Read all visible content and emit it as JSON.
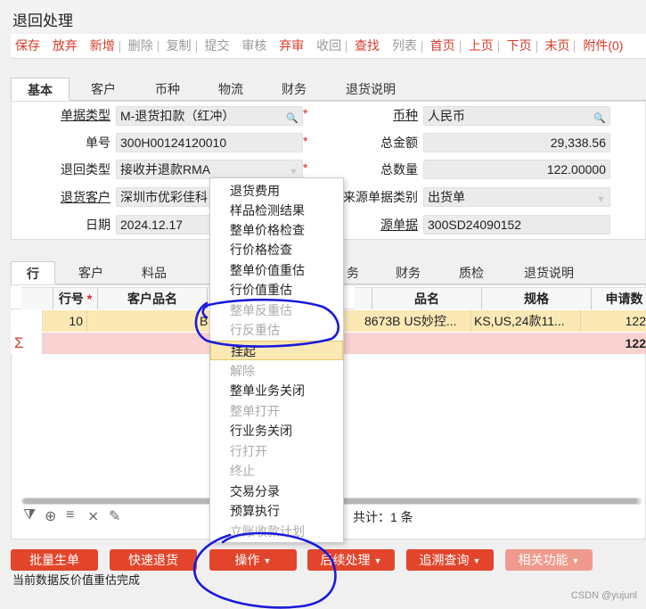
{
  "window": {
    "title": "退回处理"
  },
  "toolbar": {
    "items": [
      {
        "label": "保存",
        "disabled": false
      },
      {
        "label": "放弃",
        "disabled": false
      },
      {
        "label": "新增",
        "disabled": false
      },
      {
        "label": "删除",
        "disabled": true
      },
      {
        "label": "复制",
        "disabled": true
      },
      {
        "label": "提交",
        "disabled": true
      },
      {
        "label": "审核",
        "disabled": true
      },
      {
        "label": "弃审",
        "disabled": false
      },
      {
        "label": "收回",
        "disabled": true
      },
      {
        "label": "查找",
        "disabled": false
      },
      {
        "label": "列表",
        "disabled": true
      },
      {
        "label": "首页",
        "disabled": false
      },
      {
        "label": "上页",
        "disabled": false
      },
      {
        "label": "下页",
        "disabled": false
      },
      {
        "label": "末页",
        "disabled": false
      },
      {
        "label": "附件(0)",
        "disabled": false
      }
    ]
  },
  "header_tabs": [
    "基本",
    "客户",
    "币种",
    "物流",
    "财务",
    "退货说明"
  ],
  "form": {
    "doc_type": {
      "label": "单据类型",
      "value": "M-退货扣款（红冲）"
    },
    "currency": {
      "label": "币种",
      "value": "人民币"
    },
    "doc_no": {
      "label": "单号",
      "value": "300H00124120010"
    },
    "total_amount": {
      "label": "总金额",
      "value": "29,338.56"
    },
    "return_type": {
      "label": "退回类型",
      "value": "接收并退款RMA"
    },
    "total_qty": {
      "label": "总数量",
      "value": "122.00000"
    },
    "return_customer": {
      "label": "退货客户",
      "value": "深圳市优彩佳科"
    },
    "source_doc_type": {
      "label": "来源单据类别",
      "value": "出货单"
    },
    "date": {
      "label": "日期",
      "value": "2024.12.17"
    },
    "source_doc": {
      "label": "源单据",
      "value": "300SD24090152"
    }
  },
  "detail_tabs": [
    "行",
    "客户",
    "料品",
    "",
    "务",
    "财务",
    "质检",
    "退货说明"
  ],
  "grid": {
    "headers": [
      "行号",
      "客户品名",
      "",
      "",
      "品名",
      "规格",
      "申请数"
    ],
    "rows": [
      {
        "line_no": "10",
        "customer_item": "",
        "c3": "B",
        "item_name": "8673B US妙控...",
        "spec": "KS,US,24款11...",
        "qty": "122"
      }
    ],
    "sum_symbol": "Σ",
    "sum_qty": "122"
  },
  "footer": {
    "total_count": "共计：1 条"
  },
  "bottom_buttons": [
    {
      "label": "批量生单",
      "dropdown": false
    },
    {
      "label": "快速退货",
      "dropdown": false
    },
    {
      "label": "操作",
      "dropdown": true
    },
    {
      "label": "后续处理",
      "dropdown": true
    },
    {
      "label": "追溯查询",
      "dropdown": true
    },
    {
      "label": "相关功能",
      "dropdown": true
    }
  ],
  "context_menu": {
    "items": [
      {
        "label": "退货费用",
        "disabled": false
      },
      {
        "label": "样品检测结果",
        "disabled": false
      },
      {
        "label": "整单价格检查",
        "disabled": false
      },
      {
        "label": "行价格检查",
        "disabled": false
      },
      {
        "label": "整单价值重估",
        "disabled": false
      },
      {
        "label": "行价值重估",
        "disabled": false
      },
      {
        "label": "整单反重估",
        "disabled": true
      },
      {
        "label": "行反重估",
        "disabled": true
      },
      {
        "label": "挂起",
        "disabled": false,
        "highlighted": true
      },
      {
        "label": "解除",
        "disabled": true
      },
      {
        "label": "整单业务关闭",
        "disabled": false
      },
      {
        "label": "整单打开",
        "disabled": true
      },
      {
        "label": "行业务关闭",
        "disabled": false
      },
      {
        "label": "行打开",
        "disabled": true
      },
      {
        "label": "终止",
        "disabled": true
      },
      {
        "label": "交易分录",
        "disabled": false
      },
      {
        "label": "预算执行",
        "disabled": false
      },
      {
        "label": "立账收款计划",
        "disabled": true
      }
    ]
  },
  "status_text": "当前数据反价值重估完成",
  "watermark": "CSDN @yujunl",
  "colors": {
    "accent": "#e2452b",
    "annotation": "#1a1adc",
    "row_highlight": "#fbe8b5"
  }
}
